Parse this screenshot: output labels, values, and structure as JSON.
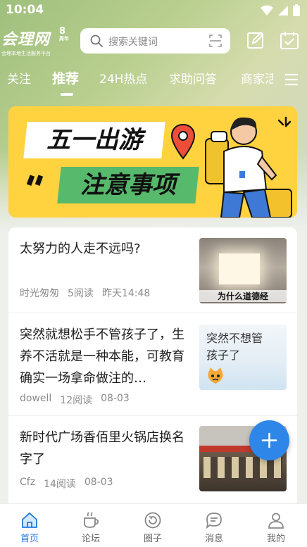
{
  "status_bar": {
    "time": "10:04"
  },
  "header": {
    "logo_text": "会理网",
    "logo_badge_number": "8",
    "logo_badge_unit": "周年",
    "logo_slogan": "会理本地生活服务平台",
    "search_placeholder": "搜索关键词"
  },
  "tabs": [
    {
      "label": "关注",
      "active": false
    },
    {
      "label": "推荐",
      "active": true
    },
    {
      "label": "24H热点",
      "active": false
    },
    {
      "label": "求助问答",
      "active": false
    },
    {
      "label": "商家活",
      "active": false
    }
  ],
  "banner": {
    "line1": "五一出游",
    "line2": "注意事项"
  },
  "articles": [
    {
      "title": "太努力的人走不远吗?",
      "author": "时光匆匆",
      "reads": "5阅读",
      "time": "昨天14:48",
      "thumb_caption": "为什么道德经"
    },
    {
      "title": "突然就想松手不管孩子了，生养不活就是一种本能，可教育确实一场拿命做注的…",
      "author": "dowell",
      "reads": "12阅读",
      "time": "08-03",
      "thumb_caption": "突然不想管孩子了"
    },
    {
      "title": "新时代广场香佰里火锅店换名字了",
      "author": "Cfz",
      "reads": "14阅读",
      "time": "08-03",
      "thumb_caption": ""
    }
  ],
  "bottom_nav": [
    {
      "label": "首页",
      "icon": "home-icon",
      "active": true
    },
    {
      "label": "论坛",
      "icon": "cup-icon",
      "active": false
    },
    {
      "label": "圈子",
      "icon": "circle-refresh-icon",
      "active": false
    },
    {
      "label": "消息",
      "icon": "chat-bubble-icon",
      "active": false
    },
    {
      "label": "我的",
      "icon": "person-icon",
      "active": false
    }
  ],
  "colors": {
    "accent": "#1e7be0",
    "fab": "#2e86e8",
    "banner_yellow": "#ffd23f",
    "banner_green": "#57b96b"
  }
}
